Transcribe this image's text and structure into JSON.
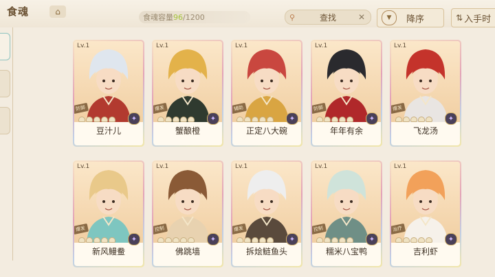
{
  "header": {
    "title": "食魂",
    "capacity_label": "食魂容量",
    "capacity_current": "96",
    "capacity_max": "/1200",
    "search_label": "查找",
    "sort_label": "降序",
    "enter_label": "入手时"
  },
  "icons": {
    "home": "home-icon",
    "search": "search-icon",
    "clear": "close-icon",
    "sort": "sort-down-icon",
    "swap": "swap-vertical-icon",
    "element": "element-icon"
  },
  "colors": {
    "background": "#f3ece0",
    "accent": "#6b5233",
    "capacity_current": "#a6c23e"
  },
  "cards": [
    {
      "level": "Lv.1",
      "role": "防御",
      "name": "豆汁儿",
      "hair": "#dfe6ee",
      "outfit": "#b23a2f"
    },
    {
      "level": "Lv.1",
      "role": "爆发",
      "name": "蟹酿橙",
      "hair": "#e3b24a",
      "outfit": "#2f3a2f"
    },
    {
      "level": "Lv.1",
      "role": "辅助",
      "name": "正定八大碗",
      "hair": "#c9473f",
      "outfit": "#d9a542"
    },
    {
      "level": "Lv.1",
      "role": "防御",
      "name": "年年有余",
      "hair": "#2a2a2e",
      "outfit": "#b0282a"
    },
    {
      "level": "Lv.1",
      "role": "爆发",
      "name": "飞龙汤",
      "hair": "#c4332b",
      "outfit": "#e9e5e2"
    },
    {
      "level": "Lv.1",
      "role": "爆发",
      "name": "新风鳗鲞",
      "hair": "#e9c98a",
      "outfit": "#7ec6c0"
    },
    {
      "level": "Lv.1",
      "role": "控制",
      "name": "佛跳墙",
      "hair": "#8a5a36",
      "outfit": "#e8d2b0"
    },
    {
      "level": "Lv.1",
      "role": "爆发",
      "name": "拆烩鲢鱼头",
      "hair": "#eeeeee",
      "outfit": "#5a4a3c"
    },
    {
      "level": "Lv.1",
      "role": "控制",
      "name": "糯米八宝鸭",
      "hair": "#cfe3da",
      "outfit": "#6f8f86"
    },
    {
      "level": "Lv.1",
      "role": "治疗",
      "name": "吉利虾",
      "hair": "#f2a15a",
      "outfit": "#f6f1ea"
    }
  ]
}
